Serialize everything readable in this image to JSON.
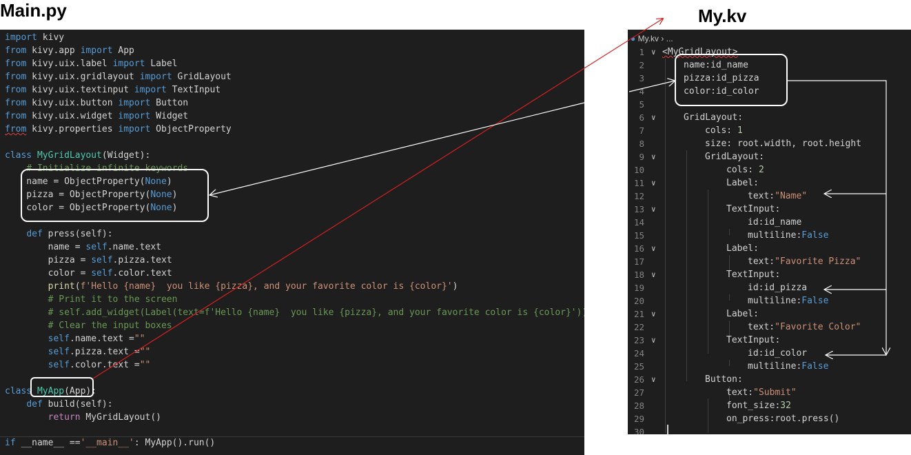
{
  "titles": {
    "main": "Main.py",
    "kv": "My.kv"
  },
  "kv_breadcrumb": {
    "file": "My.kv",
    "rest": "..."
  },
  "py_lines": [
    [
      [
        "k",
        "import"
      ],
      [
        "t",
        " kivy"
      ]
    ],
    [
      [
        "k",
        "from"
      ],
      [
        "t",
        " kivy.app "
      ],
      [
        "k",
        "import"
      ],
      [
        "t",
        " App"
      ]
    ],
    [
      [
        "k",
        "from"
      ],
      [
        "t",
        " kivy.uix.label "
      ],
      [
        "k",
        "import"
      ],
      [
        "t",
        " Label"
      ]
    ],
    [
      [
        "k",
        "from"
      ],
      [
        "t",
        " kivy.uix.gridlayout "
      ],
      [
        "k",
        "import"
      ],
      [
        "t",
        " GridLayout"
      ]
    ],
    [
      [
        "k",
        "from"
      ],
      [
        "t",
        " kivy.uix.textinput "
      ],
      [
        "k",
        "import"
      ],
      [
        "t",
        " TextInput"
      ]
    ],
    [
      [
        "k",
        "from"
      ],
      [
        "t",
        " kivy.uix.button "
      ],
      [
        "k",
        "import"
      ],
      [
        "t",
        " Button"
      ]
    ],
    [
      [
        "k",
        "from"
      ],
      [
        "t",
        " kivy.uix.widget "
      ],
      [
        "k",
        "import"
      ],
      [
        "t",
        " Widget"
      ]
    ],
    [
      [
        "k sq",
        "from"
      ],
      [
        "t",
        " kivy.properties "
      ],
      [
        "k",
        "import"
      ],
      [
        "t",
        " ObjectProperty"
      ]
    ],
    [],
    [
      [
        "k",
        "class"
      ],
      [
        "t",
        " "
      ],
      [
        "c",
        "MyGridLayout"
      ],
      [
        "t",
        "(Widget):"
      ]
    ],
    [
      [
        "t",
        "    "
      ],
      [
        "cm",
        "# Initialize infinite keywords"
      ]
    ],
    [
      [
        "t",
        "    name = ObjectProperty("
      ],
      [
        "k",
        "None"
      ],
      [
        "t",
        ")"
      ]
    ],
    [
      [
        "t",
        "    pizza = ObjectProperty("
      ],
      [
        "k",
        "None"
      ],
      [
        "t",
        ")"
      ]
    ],
    [
      [
        "t",
        "    color = ObjectProperty("
      ],
      [
        "k",
        "None"
      ],
      [
        "t",
        ")"
      ]
    ],
    [],
    [
      [
        "t",
        "    "
      ],
      [
        "k",
        "def"
      ],
      [
        "t",
        " press(self):"
      ]
    ],
    [
      [
        "t",
        "        name = "
      ],
      [
        "k",
        "self"
      ],
      [
        "t",
        ".name.text"
      ]
    ],
    [
      [
        "t",
        "        pizza = "
      ],
      [
        "k",
        "self"
      ],
      [
        "t",
        ".pizza.text"
      ]
    ],
    [
      [
        "t",
        "        color = "
      ],
      [
        "k",
        "self"
      ],
      [
        "t",
        ".color.text"
      ]
    ],
    [
      [
        "t",
        "        "
      ],
      [
        "f",
        "print"
      ],
      [
        "t",
        "("
      ],
      [
        "s",
        "f'Hello {name}  you like {pizza}, and your favorite color is {color}'"
      ],
      [
        "t",
        ")"
      ]
    ],
    [
      [
        "t",
        "        "
      ],
      [
        "cm",
        "# Print it to the screen"
      ]
    ],
    [
      [
        "t",
        "        "
      ],
      [
        "cm",
        "# self.add_widget(Label(text=f'Hello {name}  you like {pizza}, and your favorite color is {color}'))"
      ]
    ],
    [
      [
        "t",
        "        "
      ],
      [
        "cm",
        "# Clear the input boxes"
      ]
    ],
    [
      [
        "t",
        "        "
      ],
      [
        "k",
        "self"
      ],
      [
        "t",
        ".name.text ="
      ],
      [
        "s",
        "\"\""
      ]
    ],
    [
      [
        "t",
        "        "
      ],
      [
        "k",
        "self"
      ],
      [
        "t",
        ".pizza.text ="
      ],
      [
        "s",
        "\"\""
      ]
    ],
    [
      [
        "t",
        "        "
      ],
      [
        "k",
        "self"
      ],
      [
        "t",
        ".color.text ="
      ],
      [
        "s",
        "\"\""
      ]
    ],
    [],
    [
      [
        "k",
        "class"
      ],
      [
        "t",
        " "
      ],
      [
        "c",
        "MyApp"
      ],
      [
        "t",
        "(App):"
      ]
    ],
    [
      [
        "t",
        "    "
      ],
      [
        "k",
        "def"
      ],
      [
        "t",
        " build(self):"
      ]
    ],
    [
      [
        "t",
        "        "
      ],
      [
        "kw",
        "return"
      ],
      [
        "t",
        " MyGridLayout()"
      ]
    ],
    [],
    [
      [
        "k",
        "if"
      ],
      [
        "t",
        " __name__ =="
      ],
      [
        "s",
        "'__main__'"
      ],
      [
        "t",
        ": MyApp().run()"
      ]
    ]
  ],
  "kv_lines": [
    {
      "n": "1",
      "fold": "v",
      "indent": 0,
      "seg": [
        [
          "t sq",
          "<MyGridLayout>"
        ]
      ]
    },
    {
      "n": "2",
      "indent": 1,
      "seg": [
        [
          "t",
          "name:id_name"
        ]
      ]
    },
    {
      "n": "3",
      "indent": 1,
      "seg": [
        [
          "t",
          "pizza:id_pizza"
        ]
      ]
    },
    {
      "n": "4",
      "indent": 1,
      "seg": [
        [
          "t",
          "color:id_color"
        ]
      ]
    },
    {
      "n": "5",
      "indent": 1,
      "seg": []
    },
    {
      "n": "6",
      "fold": "v",
      "indent": 1,
      "seg": [
        [
          "t",
          "GridLayout:"
        ]
      ]
    },
    {
      "n": "7",
      "indent": 2,
      "seg": [
        [
          "t",
          "cols: "
        ],
        [
          "n",
          "1"
        ]
      ]
    },
    {
      "n": "8",
      "indent": 2,
      "seg": [
        [
          "t",
          "size: root.width, root.height"
        ]
      ]
    },
    {
      "n": "9",
      "fold": "v",
      "indent": 2,
      "seg": [
        [
          "t",
          "GridLayout:"
        ]
      ]
    },
    {
      "n": "10",
      "indent": 3,
      "seg": [
        [
          "t",
          "cols: "
        ],
        [
          "n",
          "2"
        ]
      ]
    },
    {
      "n": "11",
      "fold": "v",
      "indent": 3,
      "seg": [
        [
          "t",
          "Label:"
        ]
      ]
    },
    {
      "n": "12",
      "indent": 4,
      "seg": [
        [
          "t",
          "text:"
        ],
        [
          "s",
          "\"Name\""
        ]
      ]
    },
    {
      "n": "13",
      "fold": "v",
      "indent": 3,
      "seg": [
        [
          "t",
          "TextInput:"
        ]
      ]
    },
    {
      "n": "14",
      "indent": 4,
      "seg": [
        [
          "t",
          "id:id_name"
        ]
      ]
    },
    {
      "n": "15",
      "indent": 4,
      "seg": [
        [
          "t",
          "multiline:"
        ],
        [
          "k",
          "False"
        ]
      ]
    },
    {
      "n": "16",
      "fold": "v",
      "indent": 3,
      "seg": [
        [
          "t",
          "Label:"
        ]
      ]
    },
    {
      "n": "17",
      "indent": 4,
      "seg": [
        [
          "t",
          "text:"
        ],
        [
          "s",
          "\"Favorite Pizza\""
        ]
      ]
    },
    {
      "n": "18",
      "fold": "v",
      "indent": 3,
      "seg": [
        [
          "t",
          "TextInput:"
        ]
      ]
    },
    {
      "n": "19",
      "indent": 4,
      "seg": [
        [
          "t",
          "id:id_pizza"
        ]
      ]
    },
    {
      "n": "20",
      "indent": 4,
      "seg": [
        [
          "t",
          "multiline:"
        ],
        [
          "k",
          "False"
        ]
      ]
    },
    {
      "n": "21",
      "fold": "v",
      "indent": 3,
      "seg": [
        [
          "t",
          "Label:"
        ]
      ]
    },
    {
      "n": "22",
      "indent": 4,
      "seg": [
        [
          "t",
          "text:"
        ],
        [
          "s",
          "\"Favorite Color\""
        ]
      ]
    },
    {
      "n": "23",
      "fold": "v",
      "indent": 3,
      "seg": [
        [
          "t",
          "TextInput:"
        ]
      ]
    },
    {
      "n": "24",
      "indent": 4,
      "seg": [
        [
          "t",
          "id:id_color"
        ]
      ]
    },
    {
      "n": "25",
      "indent": 4,
      "seg": [
        [
          "t",
          "multiline:"
        ],
        [
          "k",
          "False"
        ]
      ]
    },
    {
      "n": "26",
      "fold": "v",
      "indent": 2,
      "seg": [
        [
          "t",
          "Button:"
        ]
      ]
    },
    {
      "n": "27",
      "indent": 3,
      "seg": [
        [
          "t",
          "text:"
        ],
        [
          "s",
          "\"Submit\""
        ]
      ]
    },
    {
      "n": "28",
      "indent": 3,
      "seg": [
        [
          "t",
          "font_size:"
        ],
        [
          "n",
          "32"
        ]
      ]
    },
    {
      "n": "29",
      "indent": 3,
      "seg": [
        [
          "t",
          "on_press:root.press()"
        ]
      ]
    },
    {
      "n": "30",
      "indent": 0,
      "seg": []
    }
  ]
}
